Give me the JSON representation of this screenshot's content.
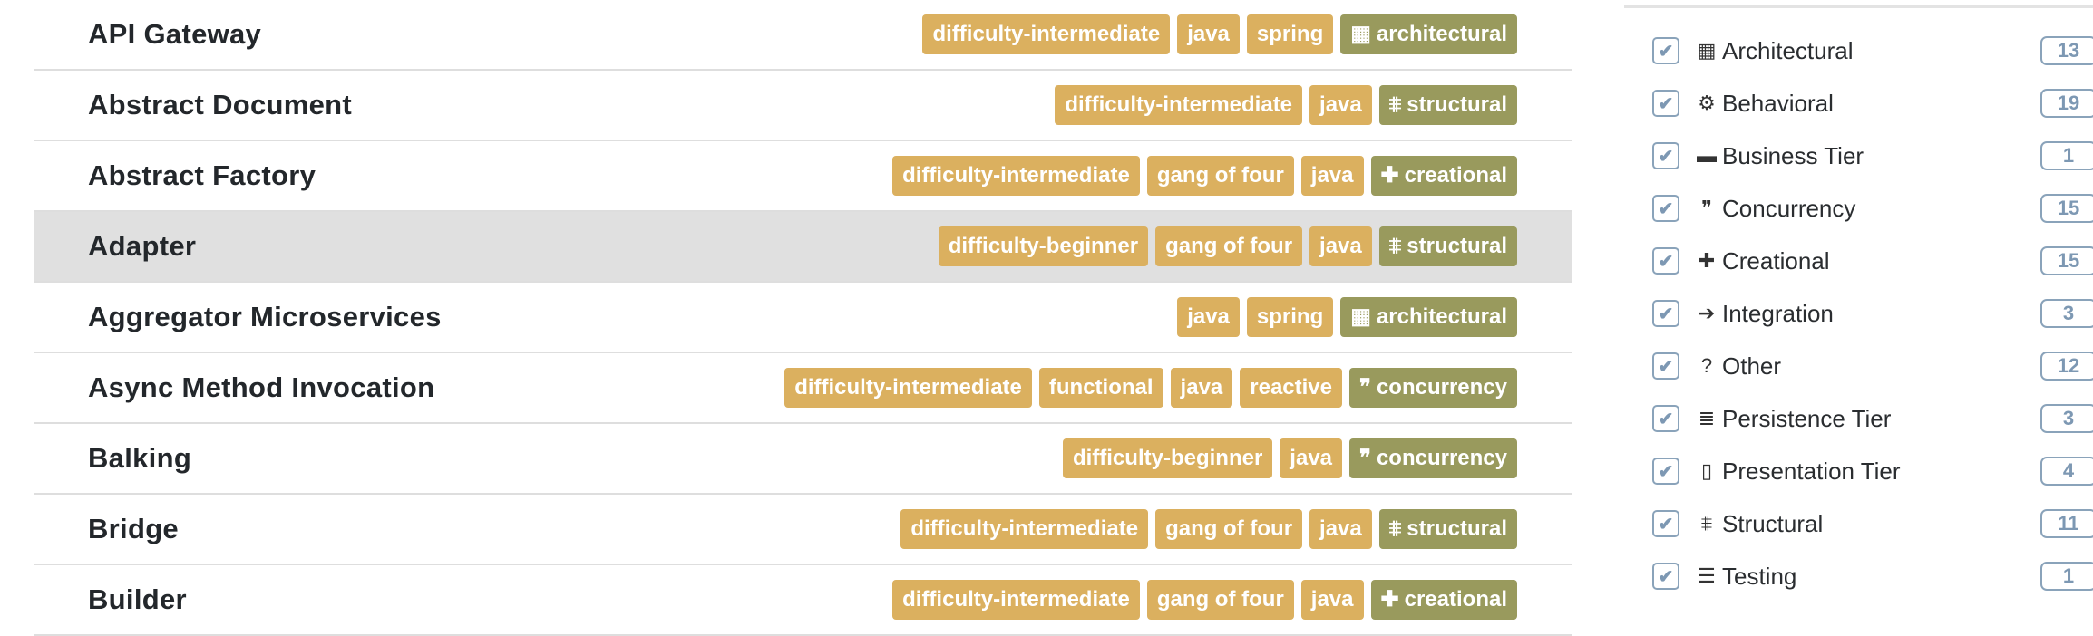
{
  "colors": {
    "tag": "#dbb05f",
    "category_tag": "#999a5d",
    "highlight": "#e0e0e0",
    "checkbox": "#8aa3ba"
  },
  "patterns": [
    {
      "name": "API Gateway",
      "tags": [
        "difficulty-intermediate",
        "java",
        "spring"
      ],
      "category": {
        "label": "architectural",
        "icon": "building-icon"
      }
    },
    {
      "name": "Abstract Document",
      "tags": [
        "difficulty-intermediate",
        "java"
      ],
      "category": {
        "label": "structural",
        "icon": "bank-icon"
      }
    },
    {
      "name": "Abstract Factory",
      "tags": [
        "difficulty-intermediate",
        "gang of four",
        "java"
      ],
      "category": {
        "label": "creational",
        "icon": "plus-icon"
      }
    },
    {
      "name": "Adapter",
      "tags": [
        "difficulty-beginner",
        "gang of four",
        "java"
      ],
      "category": {
        "label": "structural",
        "icon": "bank-icon"
      },
      "highlighted": true
    },
    {
      "name": "Aggregator Microservices",
      "tags": [
        "java",
        "spring"
      ],
      "category": {
        "label": "architectural",
        "icon": "building-icon"
      }
    },
    {
      "name": "Async Method Invocation",
      "tags": [
        "difficulty-intermediate",
        "functional",
        "java",
        "reactive"
      ],
      "category": {
        "label": "concurrency",
        "icon": "comments-icon"
      }
    },
    {
      "name": "Balking",
      "tags": [
        "difficulty-beginner",
        "java"
      ],
      "category": {
        "label": "concurrency",
        "icon": "comments-icon"
      }
    },
    {
      "name": "Bridge",
      "tags": [
        "difficulty-intermediate",
        "gang of four",
        "java"
      ],
      "category": {
        "label": "structural",
        "icon": "bank-icon"
      }
    },
    {
      "name": "Builder",
      "tags": [
        "difficulty-intermediate",
        "gang of four",
        "java"
      ],
      "category": {
        "label": "creational",
        "icon": "plus-icon"
      }
    }
  ],
  "filters": [
    {
      "label": "Architectural",
      "count": "13",
      "icon": "building-icon",
      "checked": true
    },
    {
      "label": "Behavioral",
      "count": "19",
      "icon": "gears-icon",
      "checked": true
    },
    {
      "label": "Business Tier",
      "count": "1",
      "icon": "briefcase-icon",
      "checked": true
    },
    {
      "label": "Concurrency",
      "count": "15",
      "icon": "comments-icon",
      "checked": true
    },
    {
      "label": "Creational",
      "count": "15",
      "icon": "plus-icon",
      "checked": true
    },
    {
      "label": "Integration",
      "count": "3",
      "icon": "sign-in-icon",
      "checked": true
    },
    {
      "label": "Other",
      "count": "12",
      "icon": "question-icon",
      "checked": true
    },
    {
      "label": "Persistence Tier",
      "count": "3",
      "icon": "database-icon",
      "checked": true
    },
    {
      "label": "Presentation Tier",
      "count": "4",
      "icon": "file-powerpoint-icon",
      "checked": true
    },
    {
      "label": "Structural",
      "count": "11",
      "icon": "bank-icon",
      "checked": true
    },
    {
      "label": "Testing",
      "count": "1",
      "icon": "list-icon",
      "checked": true
    }
  ]
}
